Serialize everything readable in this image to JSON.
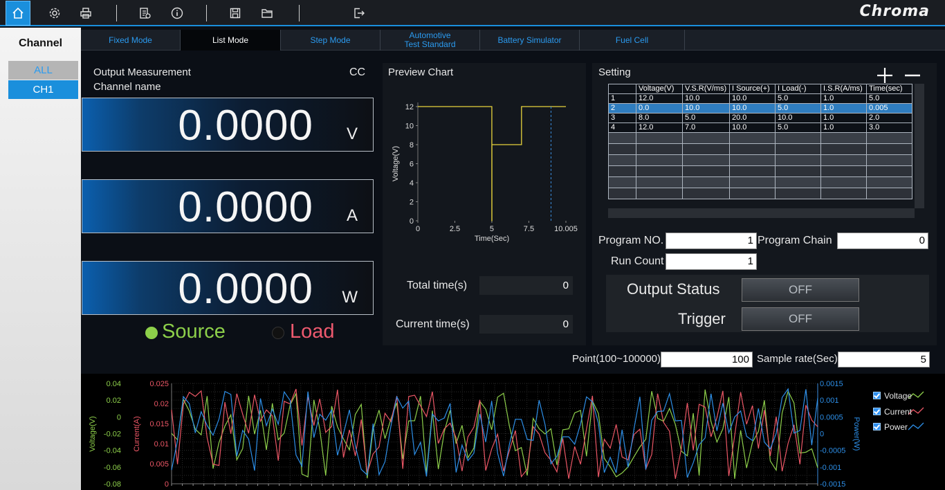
{
  "app": {
    "logo": "Chroma"
  },
  "toolbar": {
    "icons": [
      "home-icon",
      "settings-icon",
      "print-icon",
      "report-icon",
      "info-icon",
      "save-icon",
      "open-folder-icon",
      "logout-icon"
    ]
  },
  "sidebar": {
    "title": "Channel",
    "items": [
      {
        "label": "ALL"
      },
      {
        "label": "CH1"
      }
    ]
  },
  "tabs": [
    {
      "label": "Fixed Mode"
    },
    {
      "label": "List Mode"
    },
    {
      "label": "Step Mode"
    },
    {
      "label": "Automotive\nTest Standard"
    },
    {
      "label": "Battery Simulator"
    },
    {
      "label": "Fuel Cell"
    }
  ],
  "active_tab": "List Mode",
  "measurement": {
    "title": "Output Measurement",
    "subtitle": "Channel name",
    "mode": "CC",
    "voltage": {
      "value": "0.0000",
      "unit": "V"
    },
    "current": {
      "value": "0.0000",
      "unit": "A"
    },
    "power": {
      "value": "0.0000",
      "unit": "W"
    },
    "source_label": "Source",
    "load_label": "Load",
    "colors": {
      "source": "#8dd04a",
      "load": "#ee5a6f"
    }
  },
  "preview": {
    "title": "Preview Chart",
    "total_time_label": "Total time(s)",
    "total_time": "0",
    "current_time_label": "Current time(s)",
    "current_time": "0"
  },
  "chart_data": [
    {
      "type": "line",
      "xlabel": "Time(Sec)",
      "ylabel": "Voltage(V)",
      "x_ticks": [
        "0",
        "2.5",
        "5",
        "7.5",
        "10.005"
      ],
      "y_ticks": [
        "0",
        "2",
        "4",
        "6",
        "8",
        "10",
        "12"
      ],
      "xlim": [
        0,
        10.005
      ],
      "ylim": [
        0,
        12
      ],
      "series": [
        {
          "x": [
            0,
            5,
            5,
            5.005,
            5.005,
            7.005,
            7.005,
            10.005
          ],
          "y": [
            12,
            12,
            0,
            0,
            8,
            8,
            12,
            12
          ]
        }
      ],
      "marker_x": 9
    },
    {
      "type": "line",
      "y_left_label": "Voltage(V)",
      "y_left2_label": "Current(A)",
      "y_right_label": "Power(W)",
      "voltage_ticks": [
        "0.04",
        "0.02",
        "0",
        "-0.02",
        "-0.04",
        "-0.06",
        "-0.08"
      ],
      "current_ticks": [
        "0.025",
        "0.02",
        "0.015",
        "0.01",
        "0.005",
        "0"
      ],
      "power_ticks": [
        "0.0015",
        "0.001",
        "0.0005",
        "0",
        "-0.0005",
        "-0.001",
        "-0.0015"
      ],
      "series": [
        {
          "name": "Voltage",
          "color": "#8ed04b"
        },
        {
          "name": "Current",
          "color": "#ec5766"
        },
        {
          "name": "Power",
          "color": "#2d8fe8"
        }
      ]
    }
  ],
  "setting": {
    "title": "Setting",
    "columns": [
      "",
      "Voltage(V)",
      "V.S.R(V/ms)",
      "I Source(+)",
      "I Load(-)",
      "I.S.R(A/ms)",
      "Time(sec)"
    ],
    "rows": [
      [
        "1",
        "12.0",
        "10.0",
        "10.0",
        "5.0",
        "1.0",
        "5.0"
      ],
      [
        "2",
        "0.0",
        "10.0",
        "10.0",
        "5.0",
        "1.0",
        "0.005"
      ],
      [
        "3",
        "8.0",
        "5.0",
        "20.0",
        "10.0",
        "1.0",
        "2.0"
      ],
      [
        "4",
        "12.0",
        "7.0",
        "10.0",
        "5.0",
        "1.0",
        "3.0"
      ]
    ],
    "selected_row": 1,
    "program_no_label": "Program NO.",
    "program_no": "1",
    "program_chain_label": "Program Chain",
    "program_chain": "0",
    "run_count_label": "Run Count",
    "run_count": "1",
    "output_status_label": "Output Status",
    "output_status": "OFF",
    "trigger_label": "Trigger",
    "trigger": "OFF"
  },
  "sampling": {
    "point_label": "Point(100~100000)",
    "point": "100",
    "rate_label": "Sample rate(Sec)",
    "rate": "5"
  }
}
